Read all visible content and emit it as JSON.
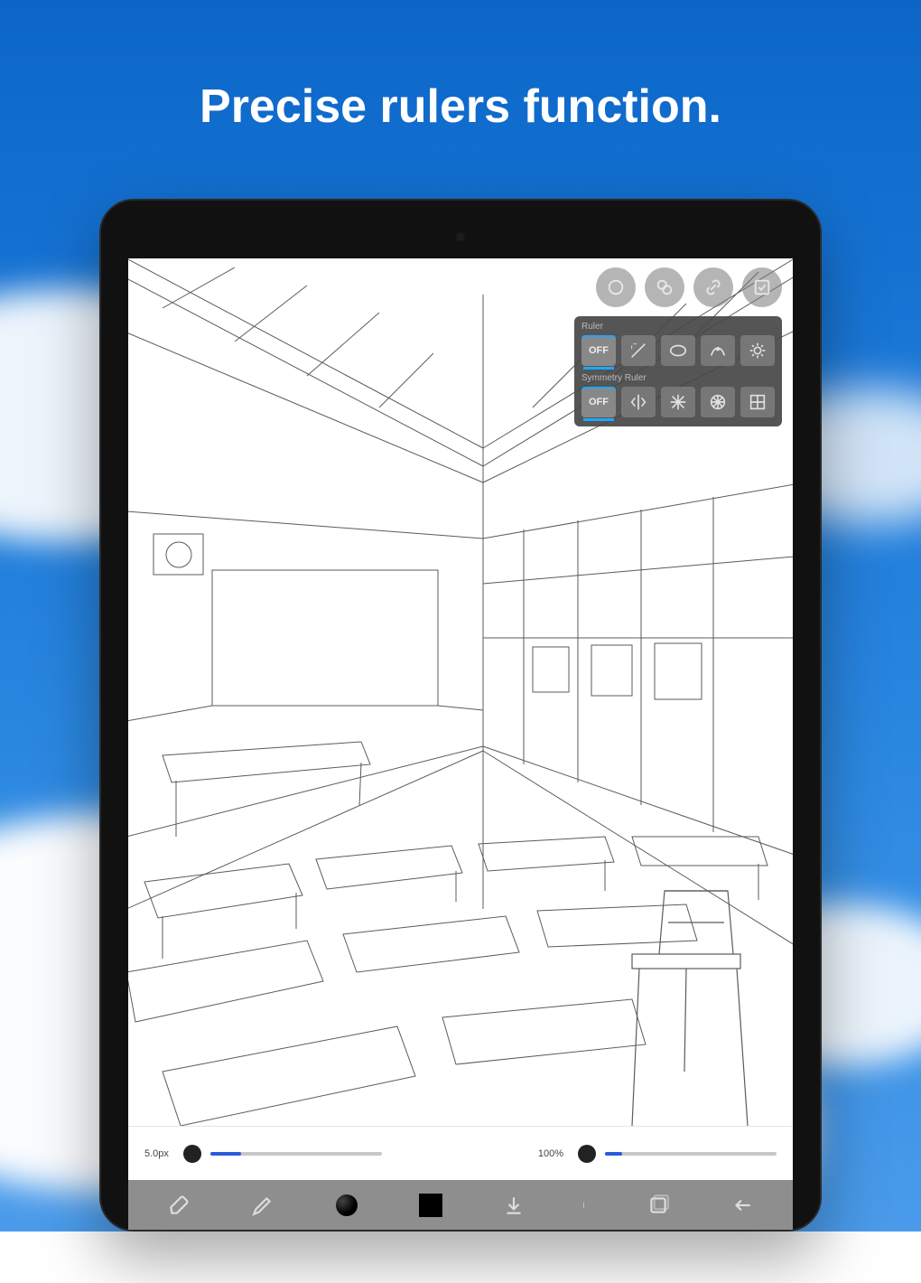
{
  "promo": {
    "headline": "Precise rulers function."
  },
  "topbar": {
    "buttons": [
      "circle-tool",
      "shapes-tool",
      "link-tool",
      "confirm-tool"
    ]
  },
  "panel": {
    "ruler": {
      "title": "Ruler",
      "off_label": "OFF",
      "items": [
        "off",
        "line-ruler",
        "ellipse-ruler",
        "curve-ruler",
        "ruler-settings"
      ]
    },
    "symmetry": {
      "title": "Symmetry Ruler",
      "off_label": "OFF",
      "items": [
        "off",
        "mirror-vertical",
        "kaleidoscope",
        "radial",
        "grid"
      ]
    }
  },
  "sliders": {
    "size": {
      "label": "5.0px",
      "percent_fill": 18
    },
    "opacity": {
      "label": "100%",
      "percent_fill": 10
    }
  },
  "toolbar": {
    "items": [
      "eraser-tool",
      "brush-tool",
      "color-picker",
      "swatch",
      "download",
      "divider",
      "layers",
      "undo"
    ]
  }
}
